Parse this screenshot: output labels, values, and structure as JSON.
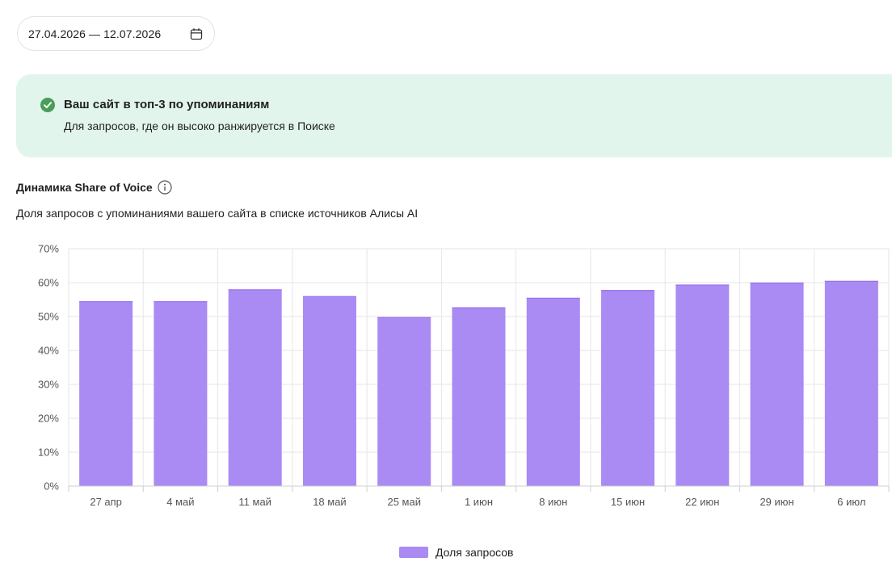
{
  "date_range": {
    "value": "27.04.2026 — 12.07.2026",
    "icon": "calendar-icon"
  },
  "banner": {
    "icon": "check-circle-icon",
    "title": "Ваш сайт в топ-3 по упоминаниям",
    "text": "Для запросов, где он высоко ранжируется в Поиске",
    "background": "#e1f5ec",
    "icon_color": "#4a9e58"
  },
  "section": {
    "title": "Динамика Share of Voice",
    "info_icon": "info-icon",
    "subtitle": "Доля запросов с упоминаниями вашего сайта в списке источников Алисы AI"
  },
  "chart_data": {
    "type": "bar",
    "categories": [
      "27 апр",
      "4 май",
      "11 май",
      "18 май",
      "25 май",
      "1 июн",
      "8 июн",
      "15 июн",
      "22 июн",
      "29 июн",
      "6 июл"
    ],
    "series": [
      {
        "name": "Доля запросов",
        "color": "#a98bf3",
        "values": [
          54.5,
          54.5,
          58.0,
          56.0,
          49.8,
          52.7,
          55.5,
          57.8,
          59.4,
          60.0,
          60.5
        ]
      }
    ],
    "ylim": [
      0,
      70
    ],
    "yticks": [
      "0%",
      "10%",
      "20%",
      "30%",
      "40%",
      "50%",
      "60%",
      "70%"
    ],
    "grid": true,
    "legend_position": "bottom-center"
  }
}
